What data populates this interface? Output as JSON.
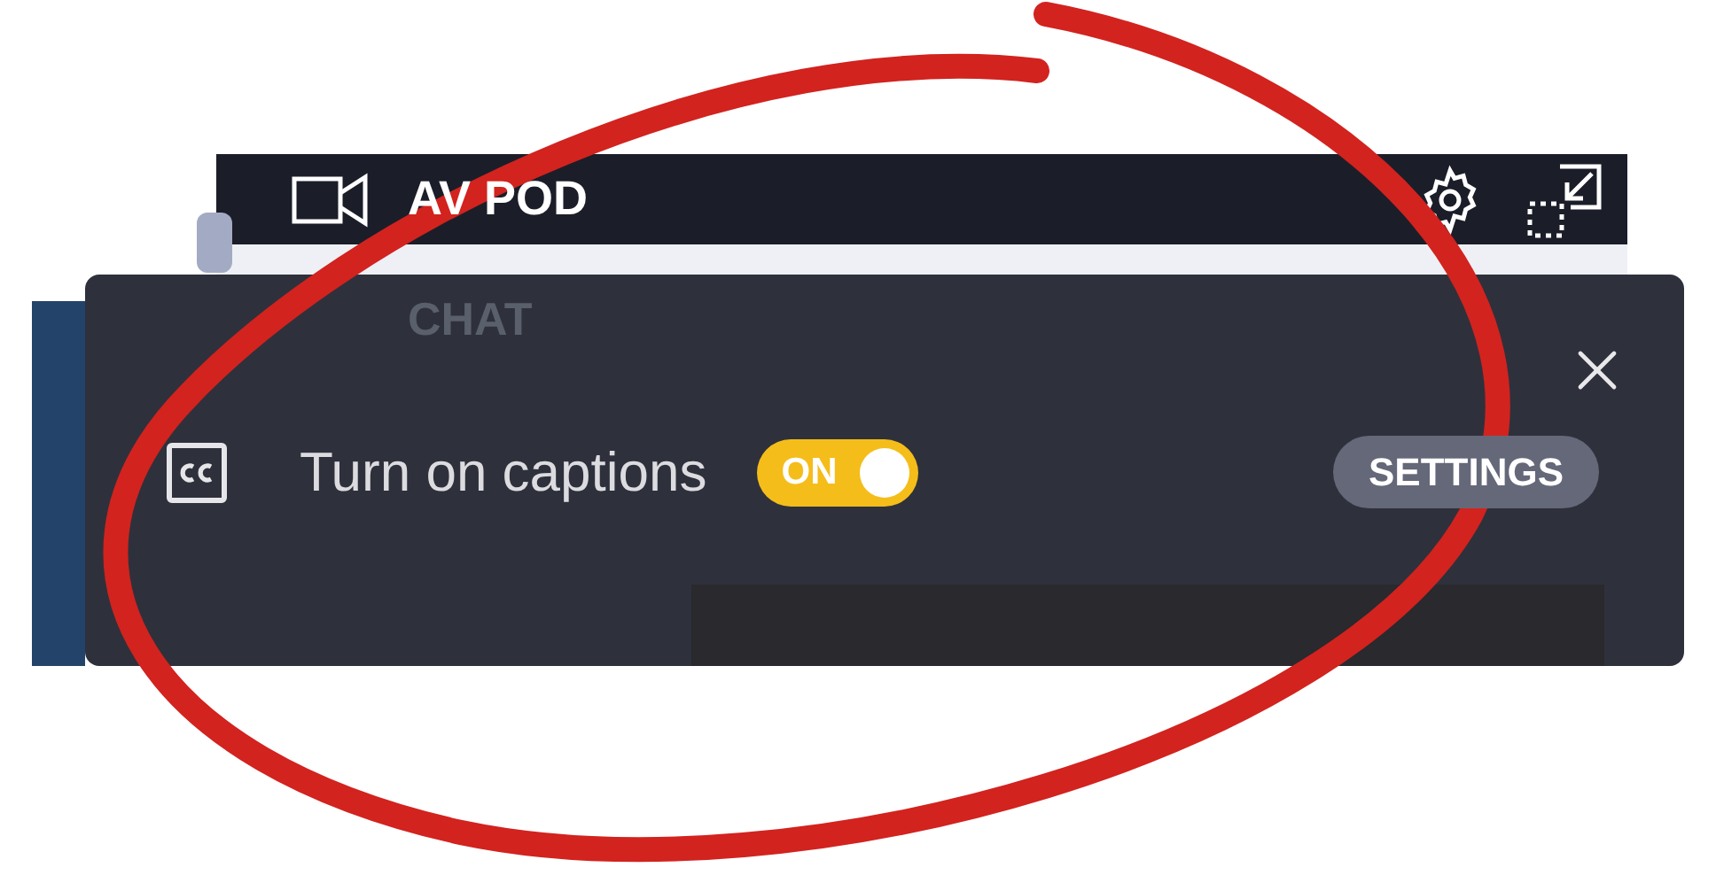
{
  "header": {
    "title": "AV POD"
  },
  "background_item": {
    "label": "CHAT"
  },
  "captions_bar": {
    "label": "Turn on captions",
    "toggle": {
      "label": "ON",
      "on": true
    },
    "settings_button": "SETTINGS"
  }
}
